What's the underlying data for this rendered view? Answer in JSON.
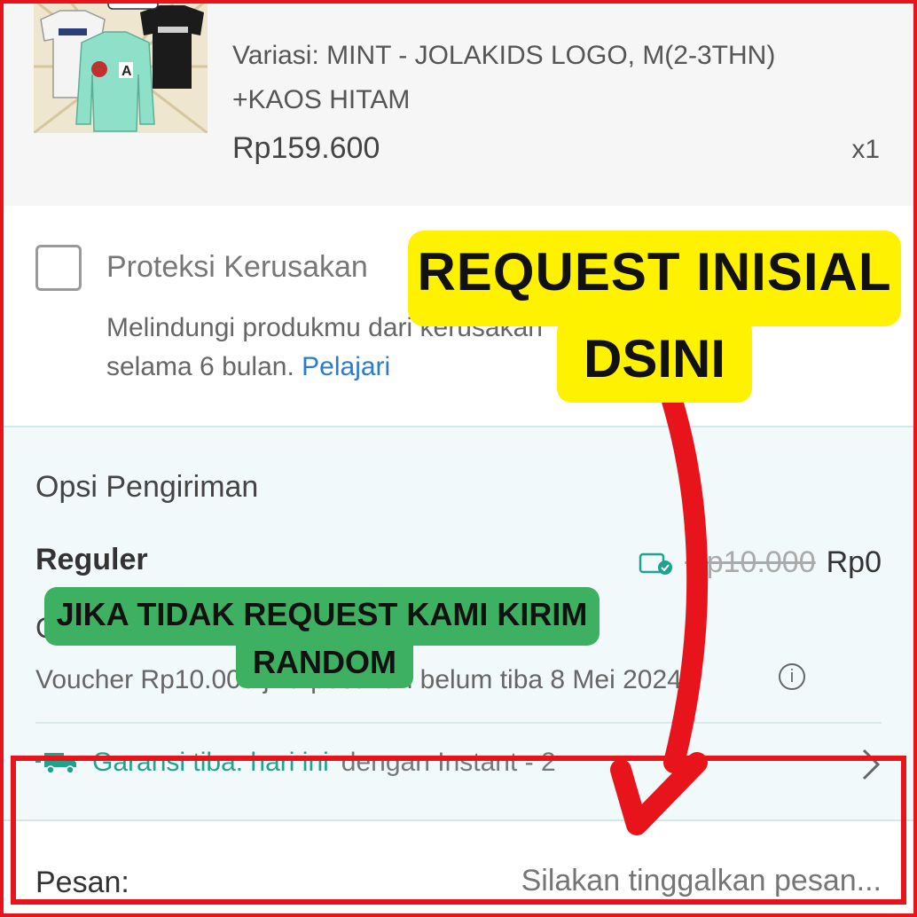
{
  "product": {
    "variant_line1": "Variasi: MINT - JOLAKIDS LOGO, M(2-3THN)",
    "variant_line2": "+KAOS HITAM",
    "price": "Rp159.600",
    "quantity": "x1"
  },
  "protection": {
    "title": "Proteksi Kerusakan",
    "description": "Melindungi produkmu dari kerusakan",
    "duration": "selama 6 bulan.",
    "learn_link": "Pelajari"
  },
  "shipping": {
    "title": "Opsi Pengiriman",
    "method": "Reguler",
    "original_price": "Rp10.000",
    "final_price": "Rp0",
    "partial_char": "C",
    "voucher_note": "Voucher Rp10.000 jika pesanan belum tiba 8 Mei 2024.",
    "info_icon": "i",
    "guarantee_green": "Garansi tiba: hari ini",
    "guarantee_grey": "dengan Instant - 2"
  },
  "message": {
    "label": "Pesan:",
    "placeholder": "Silakan tinggalkan pesan..."
  },
  "overlay": {
    "yellow_line1": "REQUEST INISIAL",
    "yellow_line2": "DSINI",
    "green_line1": "JIKA TIDAK REQUEST KAMI KIRIM",
    "green_line2": "RANDOM"
  },
  "colors": {
    "frame_red": "#e8141b",
    "callout_yellow": "#fff200",
    "callout_green": "#3db061",
    "link_blue": "#2b7bd5",
    "teal": "#22a18e"
  }
}
